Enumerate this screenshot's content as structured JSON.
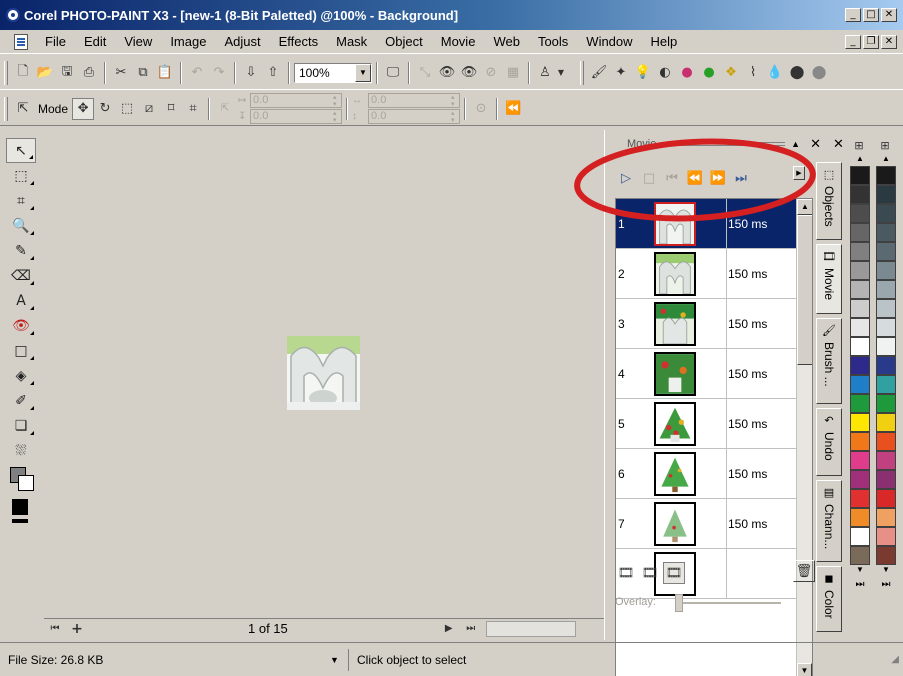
{
  "window": {
    "title": "Corel PHOTO-PAINT X3 - [new-1 (8-Bit Paletted) @100% - Background]",
    "controls": [
      "minimize",
      "maximize",
      "close"
    ]
  },
  "menubar": {
    "items": [
      "File",
      "Edit",
      "View",
      "Image",
      "Adjust",
      "Effects",
      "Mask",
      "Object",
      "Movie",
      "Web",
      "Tools",
      "Window",
      "Help"
    ]
  },
  "toolbar": {
    "zoom_value": "100%",
    "mode_label": "Mode",
    "position_x": "0.0",
    "position_y": "0.0",
    "size_w": "0.0",
    "size_h": "0.0"
  },
  "movie_panel": {
    "title": "Movie",
    "frames": [
      {
        "number": "1",
        "duration": "150 ms"
      },
      {
        "number": "2",
        "duration": "150 ms"
      },
      {
        "number": "3",
        "duration": "150 ms"
      },
      {
        "number": "4",
        "duration": "150 ms"
      },
      {
        "number": "5",
        "duration": "150 ms"
      },
      {
        "number": "6",
        "duration": "150 ms"
      },
      {
        "number": "7",
        "duration": "150 ms"
      }
    ],
    "overlay_label": "Overlay:",
    "selected_frame": "1"
  },
  "side_tabs": [
    "Objects",
    "Movie",
    "Brush ...",
    "Undo",
    "Chann...",
    "Color"
  ],
  "navigator": {
    "page_label": "1 of 15"
  },
  "statusbar": {
    "file_size": "File Size: 26.8 KB",
    "hint": "Click object to select"
  },
  "colors": {
    "accent_selection": "#0a246a",
    "highlight_circle": "#d42020",
    "palette_left": [
      "#1a1a1a",
      "#333333",
      "#4d4d4d",
      "#666666",
      "#808080",
      "#999999",
      "#b3b3b3",
      "#cccccc",
      "#e6e6e6",
      "#ffffff",
      "#2e2a8c",
      "#1e7ec8",
      "#1e9a3c",
      "#ffe600",
      "#f07818",
      "#e03c8c",
      "#a0307a",
      "#e03030",
      "#f08c28",
      "#ffffff",
      "#7a6a5a"
    ],
    "palette_right": [
      "#1a1a1a",
      "#2a3a40",
      "#3a4a50",
      "#4a5a60",
      "#5a6a70",
      "#7a8a90",
      "#9aa8ad",
      "#bac4c8",
      "#d6dcde",
      "#f0f2f2",
      "#2a3a8a",
      "#30a0a0",
      "#1e9a3c",
      "#f0d010",
      "#e85020",
      "#c04080",
      "#8a3070",
      "#d82828",
      "#f0a060",
      "#e89088",
      "#7a3a30"
    ]
  }
}
